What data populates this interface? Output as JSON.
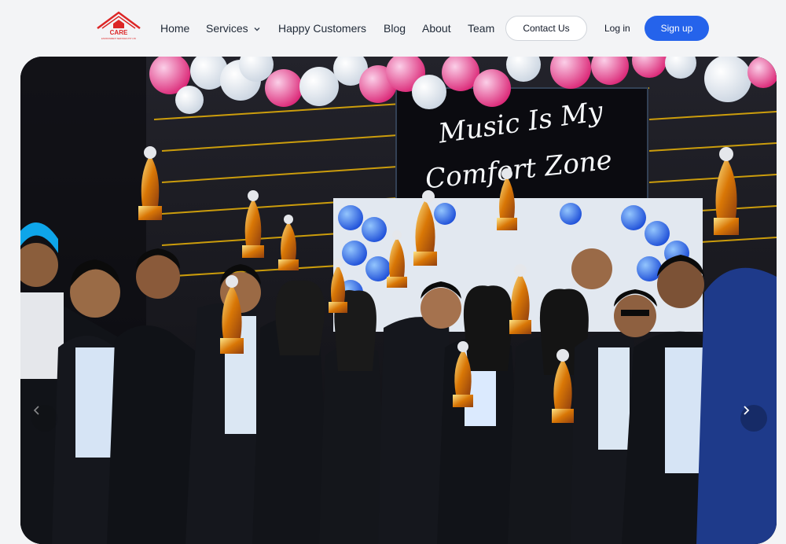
{
  "brand": {
    "logo_text": "CARE",
    "logo_subtext": "ENVIRONMENT SERVICES PVT LTD",
    "logo_icon": "house-roof-icon"
  },
  "nav": {
    "home": "Home",
    "services": "Services",
    "customers": "Happy Customers",
    "blog": "Blog",
    "about": "About",
    "team": "Team",
    "services_icon": "chevron-down-icon"
  },
  "actions": {
    "contact": "Contact Us",
    "login": "Log in",
    "signup": "Sign up"
  },
  "hero": {
    "banner_line1": "Music Is My",
    "banner_line2": "Comfort Zone",
    "image_subject": "team celebrating with trophies",
    "prev_icon": "chevron-left-icon",
    "next_icon": "chevron-right-icon"
  },
  "colors": {
    "accent": "#2563eb",
    "brand": "#dc2626",
    "nav_text": "#1f2937",
    "background": "#f3f4f6"
  }
}
